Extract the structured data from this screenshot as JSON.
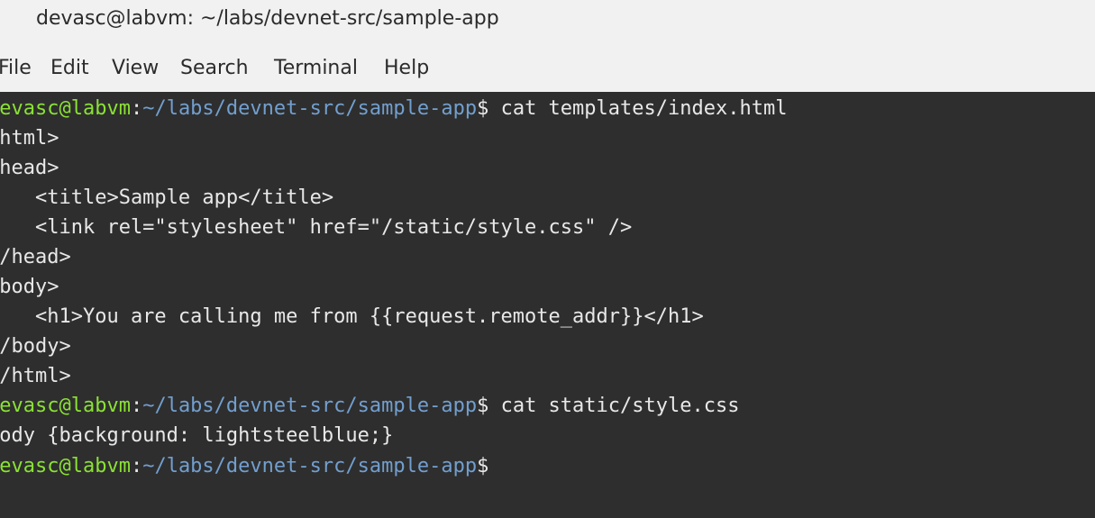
{
  "window": {
    "title": "devasc@labvm: ~/labs/devnet-src/sample-app"
  },
  "menu": [
    "File",
    "Edit",
    "View",
    "Search",
    "Terminal",
    "Help"
  ],
  "prompt": {
    "user": "devasc@labvm",
    "sep": ":",
    "path": "~/labs/devnet-src/sample-app",
    "symbol": "$"
  },
  "commands": {
    "cmd1": " cat templates/index.html",
    "cmd2": " cat static/style.css"
  },
  "output": {
    "html_file": [
      "<html>",
      "<head>",
      "    <title>Sample app</title>",
      "    <link rel=\"stylesheet\" href=\"/static/style.css\" />",
      "</head>",
      "<body>",
      "    <h1>You are calling me from {{request.remote_addr}}</h1>",
      "</body>",
      "</html>"
    ],
    "css_file": [
      "body {background: lightsteelblue;}"
    ]
  },
  "colors": {
    "terminal_bg": "#2e2e2e",
    "text": "#e8e8e8",
    "prompt_user": "#8ae234",
    "prompt_path": "#729fcf",
    "chrome_bg": "#f1f1f1"
  }
}
